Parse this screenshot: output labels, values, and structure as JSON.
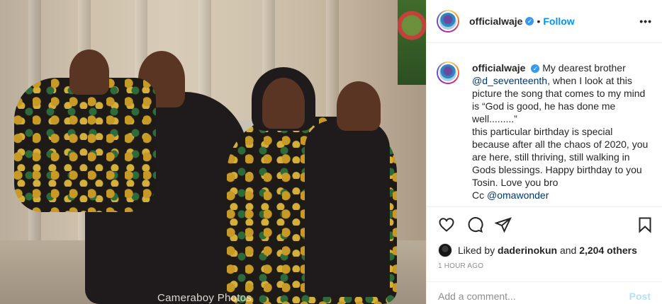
{
  "photo": {
    "watermark": "Cameraboy Photos"
  },
  "header": {
    "username": "officialwaje",
    "separator": "•",
    "follow_label": "Follow",
    "more_label": "•••"
  },
  "caption": {
    "username": "officialwaje",
    "text_1": "My dearest brother",
    "mention_1": "@d_seventeenth",
    "text_2": ", when I look at this picture the song that comes to my mind is “God is good, he has done me well.........”",
    "text_3": "this particular birthday is special because after all the chaos of 2020, you are here, still thriving, still walking in Gods blessings. Happy birthday to you Tosin. Love you bro",
    "text_4": "Cc",
    "mention_2": "@omawonder"
  },
  "actions": {
    "like_icon": "heart-icon",
    "comment_icon": "comment-icon",
    "share_icon": "share-icon",
    "save_icon": "bookmark-icon"
  },
  "likes": {
    "prefix": "Liked by",
    "user": "daderinokun",
    "middle": "and",
    "count": "2,204 others"
  },
  "timestamp": "1 HOUR AGO",
  "comment_box": {
    "placeholder": "Add a comment...",
    "post_label": "Post"
  },
  "colors": {
    "accent": "#0095f6",
    "verified": "#3897f0",
    "post_disabled": "#b2dffc"
  }
}
